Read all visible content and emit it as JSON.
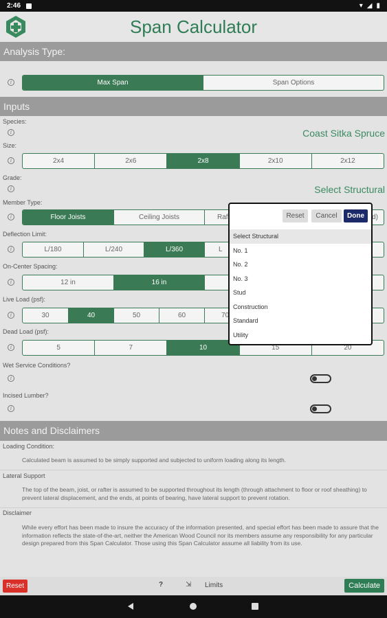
{
  "status_bar": {
    "time": "2:46"
  },
  "app": {
    "title": "Span Calculator"
  },
  "analysis": {
    "header": "Analysis Type:",
    "options": [
      "Max Span",
      "Span Options"
    ],
    "selected": "Max Span"
  },
  "inputs": {
    "header": "Inputs",
    "species": {
      "label": "Species:",
      "value": "Coast Sitka Spruce"
    },
    "size": {
      "label": "Size:",
      "options": [
        "2x4",
        "2x6",
        "2x8",
        "2x10",
        "2x12"
      ],
      "selected": "2x8"
    },
    "grade": {
      "label": "Grade:",
      "value": "Select Structural"
    },
    "member_type": {
      "label": "Member Type:",
      "options": [
        "Floor Joists",
        "Ceiling Joists",
        "Raft",
        "d)"
      ],
      "selected": "Floor Joists"
    },
    "deflection": {
      "label": "Deflection Limit:",
      "options": [
        "L/180",
        "L/240",
        "L/360",
        "L"
      ],
      "selected": "L/360"
    },
    "spacing": {
      "label": "On-Center Spacing:",
      "options": [
        "12 in",
        "16 in"
      ],
      "selected": "16 in"
    },
    "live_load": {
      "label": "Live Load (psf):",
      "options": [
        "30",
        "40",
        "50",
        "60",
        "70"
      ],
      "selected": "40"
    },
    "dead_load": {
      "label": "Dead Load (psf):",
      "options": [
        "5",
        "7",
        "10",
        "15",
        "20"
      ],
      "selected": "10"
    },
    "wet_service": {
      "label": "Wet Service Conditions?",
      "on": false
    },
    "incised": {
      "label": "Incised Lumber?",
      "on": false
    }
  },
  "notes": {
    "header": "Notes and Disclaimers",
    "items": [
      {
        "title": "Loading Condition:",
        "text": "Calculated beam is assumed to be simply supported and subjected to uniform loading along its length."
      },
      {
        "title": "Lateral Support",
        "text": "The top of the beam, joist, or rafter is assumed to be supported throughout its length (through attachment to floor or roof sheathing) to prevent lateral displacement, and the ends, at points of bearing, have lateral support to prevent rotation."
      },
      {
        "title": "Disclaimer",
        "text": "While every effort has been made to insure the accuracy of the information presented, and special effort has been made to assure that the information reflects the state-of-the-art, neither the American Wood Council nor its members assume any responsibility for any particular design prepared from this Span Calculator. Those using this Span Calculator assume all liability from its use."
      }
    ]
  },
  "bottom_bar": {
    "reset_label": "Reset",
    "help_label": "?",
    "limits_label": "Limits",
    "calculate_label": "Calculate"
  },
  "grade_picker": {
    "reset_label": "Reset",
    "cancel_label": "Cancel",
    "done_label": "Done",
    "options": [
      "Select Structural",
      "No. 1",
      "No. 2",
      "No. 3",
      "Stud",
      "Construction",
      "Standard",
      "Utility"
    ],
    "selected": "Select Structural"
  },
  "colors": {
    "accent": "#3a7a55",
    "header_bg": "#9b9b9b",
    "reset_red": "#d9302a",
    "done_navy": "#1d2a6a"
  }
}
